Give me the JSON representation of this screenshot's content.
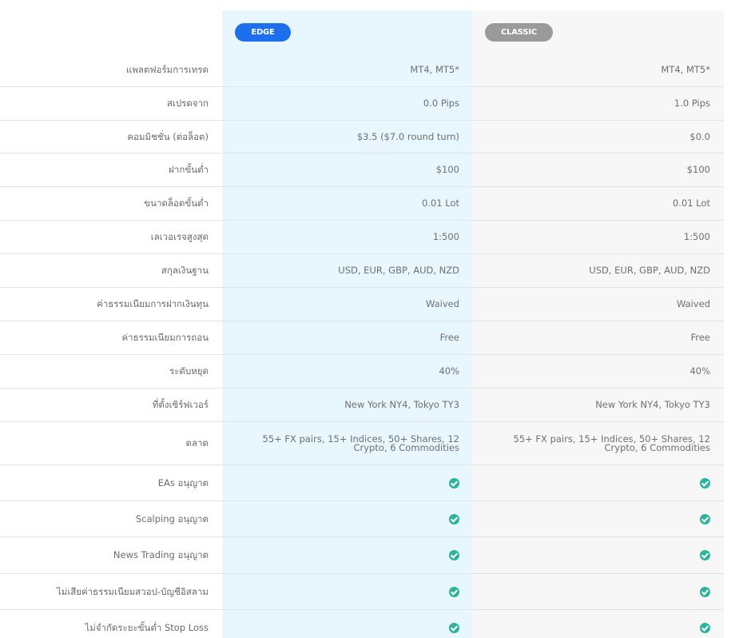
{
  "plans": {
    "edge": {
      "label": "EDGE",
      "color": "#1e6ff0"
    },
    "classic": {
      "label": "CLASSIC",
      "color": "#9a9a9a"
    }
  },
  "rows": [
    {
      "label": "แพลตฟอร์มการเทรด",
      "edge": "MT4, MT5*",
      "classic": "MT4, MT5*"
    },
    {
      "label": "สเปรดจาก",
      "edge": "0.0 Pips",
      "classic": "1.0 Pips"
    },
    {
      "label": "คอมมิชชั่น (ต่อล็อต)",
      "edge": "$3.5 ($7.0 round turn)",
      "classic": "$0.0"
    },
    {
      "label": "ฝากขั้นต่ำ",
      "edge": "$100",
      "classic": "$100"
    },
    {
      "label": "ขนาดล็อตขั้นต่ำ",
      "edge": "0.01 Lot",
      "classic": "0.01 Lot"
    },
    {
      "label": "เลเวอเรจสูงสุด",
      "edge": "1:500",
      "classic": "1:500"
    },
    {
      "label": "สกุลเงินฐาน",
      "edge": "USD, EUR, GBP, AUD, NZD",
      "classic": "USD, EUR, GBP, AUD, NZD"
    },
    {
      "label": "ค่าธรรมเนียมการฝากเงินทุน",
      "edge": "Waived",
      "classic": "Waived"
    },
    {
      "label": "ค่าธรรมเนียมการถอน",
      "edge": "Free",
      "classic": "Free"
    },
    {
      "label": "ระดับหยุด",
      "edge": "40%",
      "classic": "40%"
    },
    {
      "label": "ที่ตั้งเซิร์ฟเวอร์",
      "edge": "New York NY4, Tokyo TY3",
      "classic": "New York NY4, Tokyo TY3"
    },
    {
      "label": "ตลาด",
      "edge": "55+ FX pairs, 15+ Indices, 50+ Shares, 12 Crypto, 6 Commodities",
      "classic": "55+ FX pairs, 15+ Indices, 50+ Shares, 12 Crypto, 6 Commodities"
    },
    {
      "label": "EAs อนุญาต",
      "edge": "check-icon",
      "classic": "check-icon"
    },
    {
      "label": "Scalping อนุญาต",
      "edge": "check-icon",
      "classic": "check-icon"
    },
    {
      "label": "News Trading อนุญาต",
      "edge": "check-icon",
      "classic": "check-icon"
    },
    {
      "label": "ไม่เสียค่าธรรมเนียมสวอป-บัญชีอิสลาม",
      "edge": "check-icon",
      "classic": "check-icon"
    },
    {
      "label": "ไม่จำกัดระยะขั้นต่ำ Stop Loss",
      "edge": "check-icon",
      "classic": "check-icon"
    }
  ],
  "colors": {
    "edge_column_bg": "#e8f6fe",
    "classic_column_bg": "#f7f7f7",
    "check_color": "#2bb39c"
  }
}
